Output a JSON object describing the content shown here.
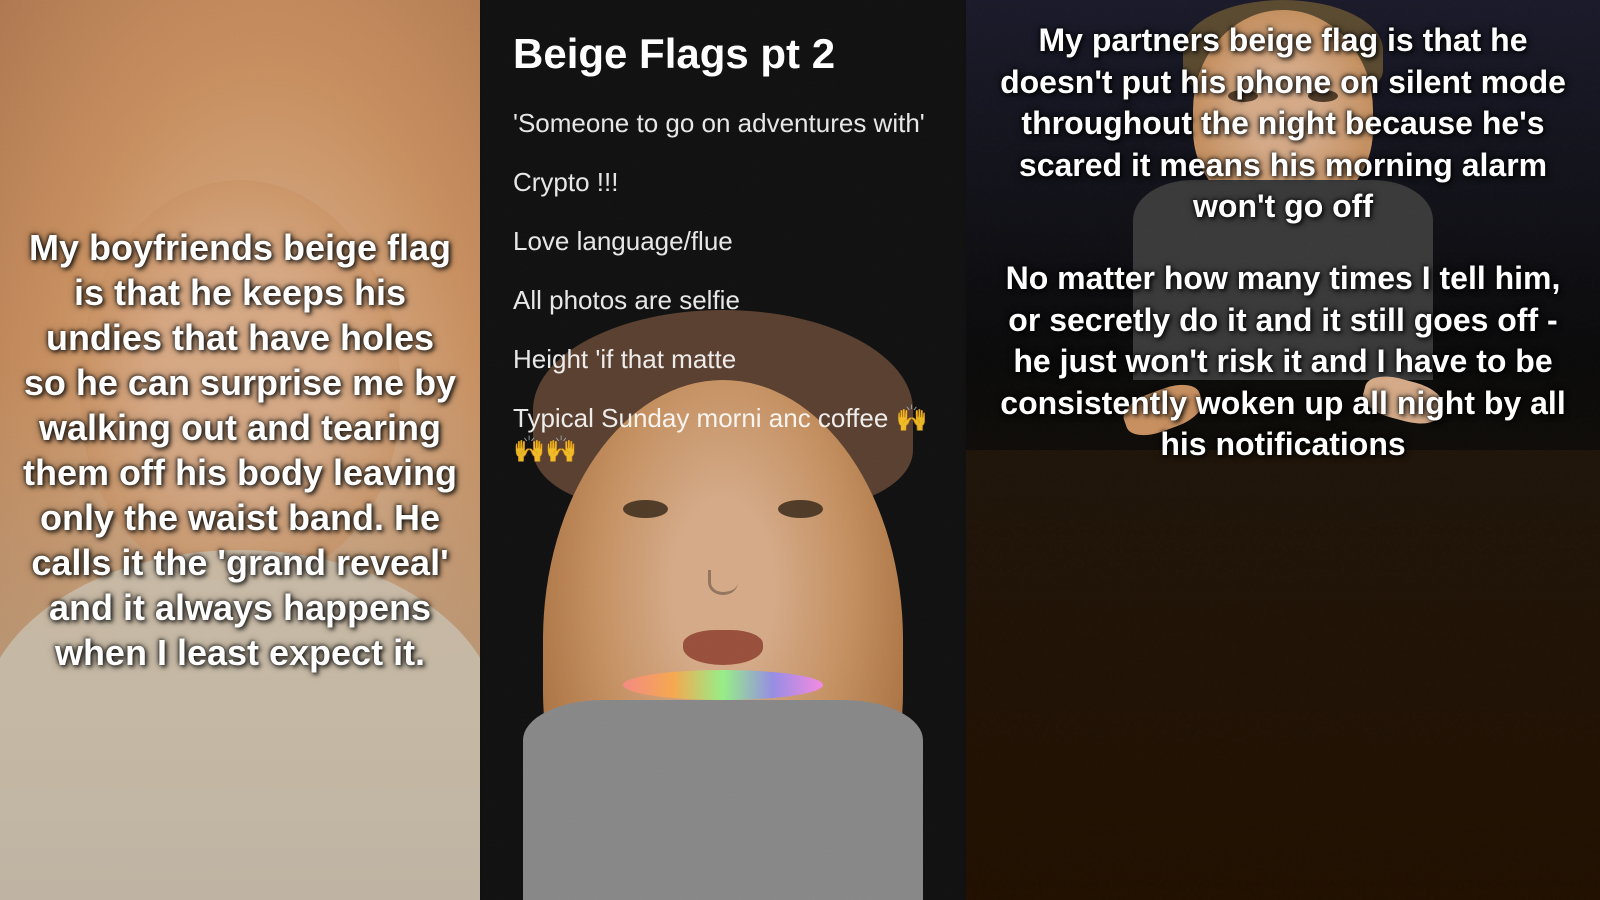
{
  "panels": {
    "left": {
      "caption": "My boyfriends beige flag is that he keeps his undies that have holes so he can surprise me by walking out and tearing them off his body leaving only the waist band. He calls it the 'grand reveal' and it always happens when I least expect it."
    },
    "center": {
      "title": "Beige Flags pt 2",
      "items": [
        "'Someone to go on adventures with'",
        "Crypto !!!",
        "Love language/flue",
        "All photos are selfie",
        "Height 'if that matte",
        "Typical Sunday morni       anc coffee 🙌🙌🙌"
      ]
    },
    "right": {
      "caption1": "My partners beige flag is that he doesn't put his phone on silent mode throughout the night because he's scared it means his morning alarm won't go off",
      "caption2": "No matter how many times I tell him, or secretly do it and it still goes off - he just won't risk it and I have to be consistently woken up all night by all his notifications"
    }
  }
}
